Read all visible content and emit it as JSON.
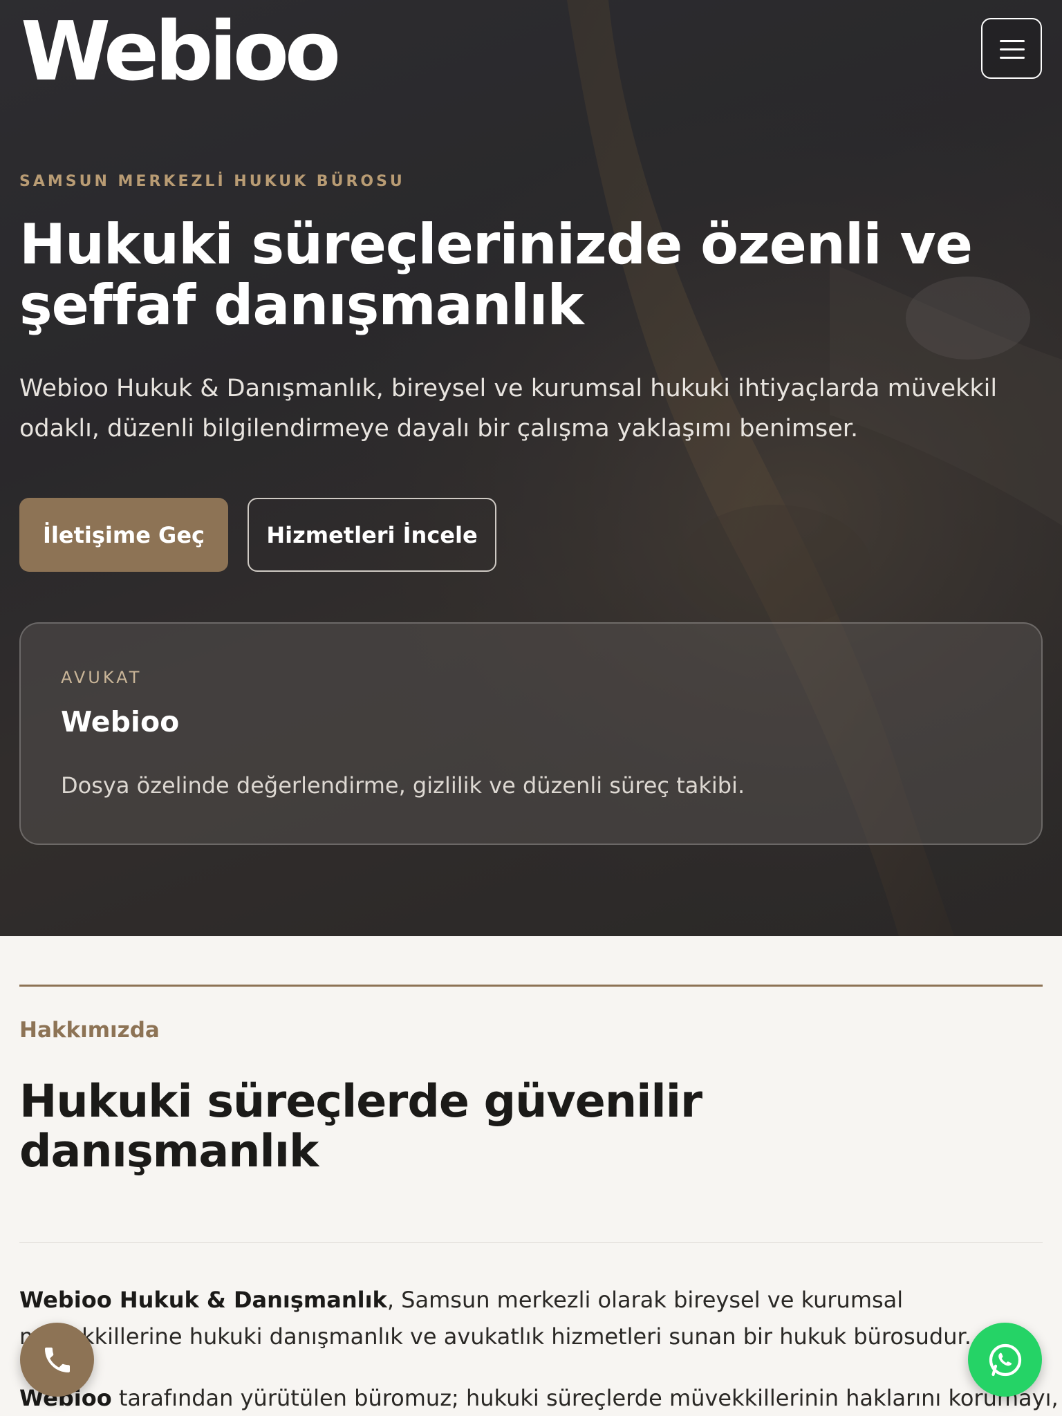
{
  "brand": {
    "logo_text": "Webioo"
  },
  "header": {
    "menu_icon": "hamburger-menu-icon"
  },
  "hero": {
    "kicker": "SAMSUN MERKEZLİ HUKUK BÜROSU",
    "title": "Hukuki süreçlerinizde özenli ve şeffaf danışmanlık",
    "description": "Webioo Hukuk & Danışmanlık, bireysel ve kurumsal hukuki ihtiyaçlarda müvekkil odaklı, düzenli bilgilendirmeye dayalı bir çalışma yaklaşımı benimser.",
    "primary_button": "İletişime Geç",
    "secondary_button": "Hizmetleri İncele",
    "card": {
      "kicker": "AVUKAT",
      "name": "Webioo",
      "description": "Dosya özelinde değerlendirme, gizlilik ve düzenli süreç takibi."
    }
  },
  "about": {
    "kicker": "Hakkımızda",
    "title": "Hukuki süreçlerde güvenilir danışmanlık",
    "p1_bold": "Webioo Hukuk & Danışmanlık",
    "p1_rest": ", Samsun merkezli olarak bireysel ve kurumsal müvekkillerine hukuki danışmanlık ve avukatlık hizmetleri sunan bir hukuk bürosudur.",
    "p2_bold": "Webioo",
    "p2_rest": " tarafından yürütülen büromuz; hukuki süreçlerde müvekkillerinin haklarını korumayı,"
  },
  "floating": {
    "phone_icon": "phone-icon",
    "whatsapp_icon": "whatsapp-icon"
  },
  "colors": {
    "accent": "#8d7355",
    "whatsapp": "#25d366",
    "hero_dark": "#2e2c2f",
    "background": "#f7f5f2"
  }
}
